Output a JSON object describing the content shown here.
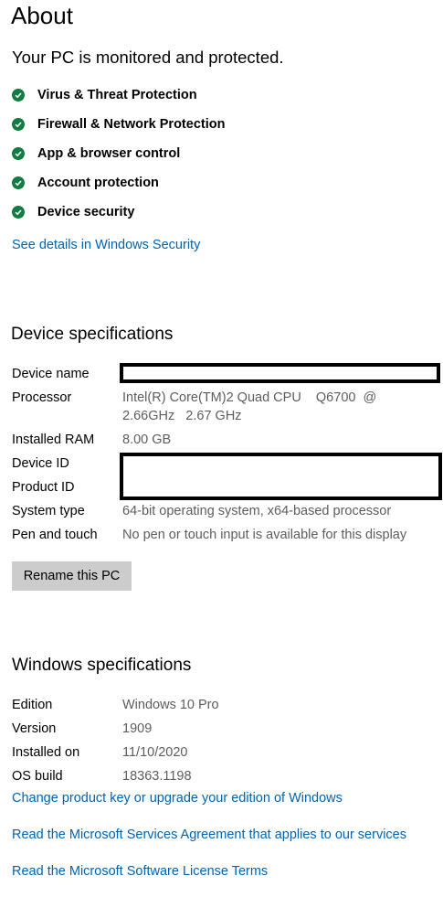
{
  "page": {
    "title": "About"
  },
  "security": {
    "status": "Your PC is monitored and protected.",
    "items": [
      {
        "label": "Virus & Threat Protection",
        "icon": "check-circle-icon"
      },
      {
        "label": "Firewall & Network Protection",
        "icon": "check-circle-icon"
      },
      {
        "label": "App & browser control",
        "icon": "check-circle-icon"
      },
      {
        "label": "Account protection",
        "icon": "check-circle-icon"
      },
      {
        "label": "Device security",
        "icon": "check-circle-icon"
      }
    ],
    "details_link": "See details in Windows Security"
  },
  "device_specs": {
    "heading": "Device specifications",
    "device_name": {
      "label": "Device name",
      "value": ""
    },
    "processor": {
      "label": "Processor",
      "value_line1": "Intel(R) Core(TM)2 Quad CPU    Q6700  @",
      "value_line2": "2.66GHz   2.67 GHz"
    },
    "ram": {
      "label": "Installed RAM",
      "value": "8.00 GB"
    },
    "device_id": {
      "label": "Device ID",
      "value": ""
    },
    "product_id": {
      "label": "Product ID",
      "value": ""
    },
    "system_type": {
      "label": "System type",
      "value": "64-bit operating system, x64-based processor"
    },
    "pen_touch": {
      "label": "Pen and touch",
      "value": "No pen or touch input is available for this display"
    },
    "rename_button": "Rename this PC"
  },
  "windows_specs": {
    "heading": "Windows specifications",
    "edition": {
      "label": "Edition",
      "value": "Windows 10 Pro"
    },
    "version": {
      "label": "Version",
      "value": "1909"
    },
    "installed_on": {
      "label": "Installed on",
      "value": "11/10/2020"
    },
    "os_build": {
      "label": "OS build",
      "value": "18363.1198"
    }
  },
  "links": {
    "change_key": "Change product key or upgrade your edition of Windows",
    "services_agreement": "Read the Microsoft Services Agreement that applies to our services",
    "license_terms": "Read the Microsoft Software License Terms"
  },
  "colors": {
    "accent_link": "#0063b1",
    "check_green": "#107c41",
    "value_gray": "#5d5d5d",
    "button_gray": "#cccccc"
  }
}
